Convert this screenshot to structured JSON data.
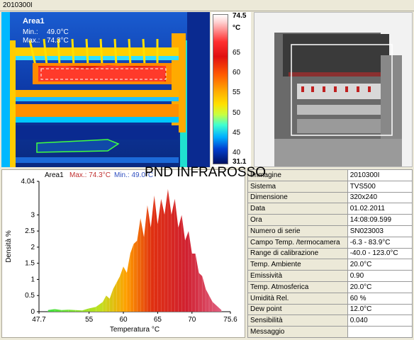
{
  "window": {
    "title": "2010300I"
  },
  "overlay_title": "PND INFRAROSSO",
  "thermal": {
    "area_label": "Area1",
    "min_label": "Min.:",
    "min_value": "49.0°C",
    "max_label": "Max.:",
    "max_value": "74.3°C"
  },
  "scale": {
    "max": "74.5",
    "unit": "°C",
    "ticks": [
      "65",
      "60",
      "55",
      "50",
      "45",
      "40"
    ],
    "min": "31.1"
  },
  "histogram": {
    "legend_area": "Area1",
    "legend_max": "Max.: 74.3°C",
    "legend_min": "Min.: 49.0°C",
    "ylabel": "Densità %",
    "xlabel": "Temperatura °C"
  },
  "chart_data": {
    "type": "area",
    "xlabel": "Temperatura °C",
    "ylabel": "Densità %",
    "xlim": [
      47.7,
      75.6
    ],
    "ylim": [
      0,
      4.04
    ],
    "x_ticks": [
      "47.7",
      "55",
      "60",
      "65",
      "70",
      "75.6"
    ],
    "y_ticks": [
      "4.04",
      "3",
      "2.5",
      "2",
      "1.5",
      "1",
      "0.5",
      "0"
    ],
    "x": [
      49.0,
      50.0,
      51.0,
      52.0,
      53.0,
      54.0,
      55.0,
      56.0,
      57.0,
      57.5,
      58.0,
      58.5,
      59.0,
      59.5,
      60.0,
      60.5,
      61.0,
      61.5,
      62.0,
      62.5,
      63.0,
      63.5,
      64.0,
      64.5,
      65.0,
      65.5,
      66.0,
      66.5,
      67.0,
      67.5,
      68.0,
      68.5,
      69.0,
      69.5,
      70.0,
      70.5,
      71.0,
      71.5,
      72.0,
      72.5,
      73.0,
      74.3
    ],
    "y": [
      0.05,
      0.08,
      0.05,
      0.06,
      0.05,
      0.04,
      0.1,
      0.15,
      0.3,
      0.5,
      0.4,
      0.7,
      0.9,
      1.1,
      1.4,
      1.2,
      1.8,
      2.1,
      2.2,
      2.9,
      2.3,
      3.3,
      2.6,
      3.6,
      2.7,
      3.5,
      3.0,
      3.8,
      3.0,
      3.5,
      2.6,
      3.0,
      2.2,
      2.5,
      1.8,
      1.8,
      1.2,
      1.1,
      0.7,
      0.5,
      0.3,
      0.05
    ],
    "grid": false,
    "legend": "top"
  },
  "info": {
    "rows": [
      {
        "key": "Immagine",
        "value": "2010300I"
      },
      {
        "key": "Sistema",
        "value": "TVS500"
      },
      {
        "key": "Dimensione",
        "value": "320x240"
      },
      {
        "key": "Data",
        "value": "01.02.2011"
      },
      {
        "key": "Ora",
        "value": "14:08:09.599"
      },
      {
        "key": "Numero di serie",
        "value": "SN023003"
      },
      {
        "key": "Campo Temp. /termocamera",
        "value": "-6.3 - 83.9°C"
      },
      {
        "key": "Range di calibrazione",
        "value": "-40.0 - 123.0°C"
      },
      {
        "key": "Temp. Ambiente",
        "value": "20.0°C"
      },
      {
        "key": "Emissività",
        "value": "0.90"
      },
      {
        "key": "Temp. Atmosferica",
        "value": "20.0°C"
      },
      {
        "key": "Umidità Rel.",
        "value": "60 %"
      },
      {
        "key": "Dew point",
        "value": "12.0°C"
      },
      {
        "key": "Sensibilità",
        "value": "0.040"
      },
      {
        "key": "Messaggio",
        "value": ""
      }
    ]
  }
}
